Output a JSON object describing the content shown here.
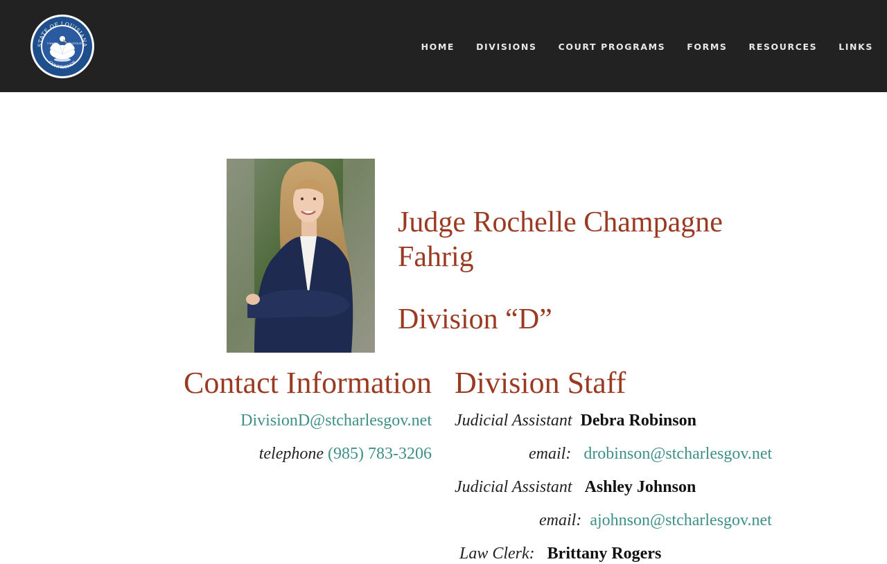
{
  "header": {
    "seal_alt": "State of Louisiana seal",
    "seal_text_top": "STATE OF LOUISIANA",
    "seal_text_bottom": "CONFIDENCE",
    "seal_motto_left": "UNION",
    "seal_motto_right": "JUSTICE",
    "nav": [
      {
        "label": "HOME"
      },
      {
        "label": "DIVISIONS"
      },
      {
        "label": "COURT PROGRAMS"
      },
      {
        "label": "FORMS"
      },
      {
        "label": "RESOURCES"
      },
      {
        "label": "LINKS"
      }
    ]
  },
  "judge": {
    "name": "Judge Rochelle Champagne Fahrig",
    "division": "Division “D”"
  },
  "contact": {
    "title": "Contact Information",
    "email": "DivisionD@stcharlesgov.net",
    "telephone_label": "telephone",
    "telephone": "(985) 783-3206"
  },
  "staff": {
    "title": "Division Staff",
    "members": [
      {
        "role": "Judicial Assistant",
        "name": "Debra Robinson",
        "email_label": "email:",
        "email": "drobinson@stcharlesgov.net"
      },
      {
        "role": "Judicial Assistant",
        "name": "Ashley Johnson",
        "email_label": "email:",
        "email": "ajohnson@stcharlesgov.net"
      },
      {
        "role": "Law Clerk:",
        "name": "Brittany Rogers"
      }
    ]
  },
  "colors": {
    "header_bg": "#222222",
    "heading": "#9b3a22",
    "link": "#3d8f87"
  }
}
